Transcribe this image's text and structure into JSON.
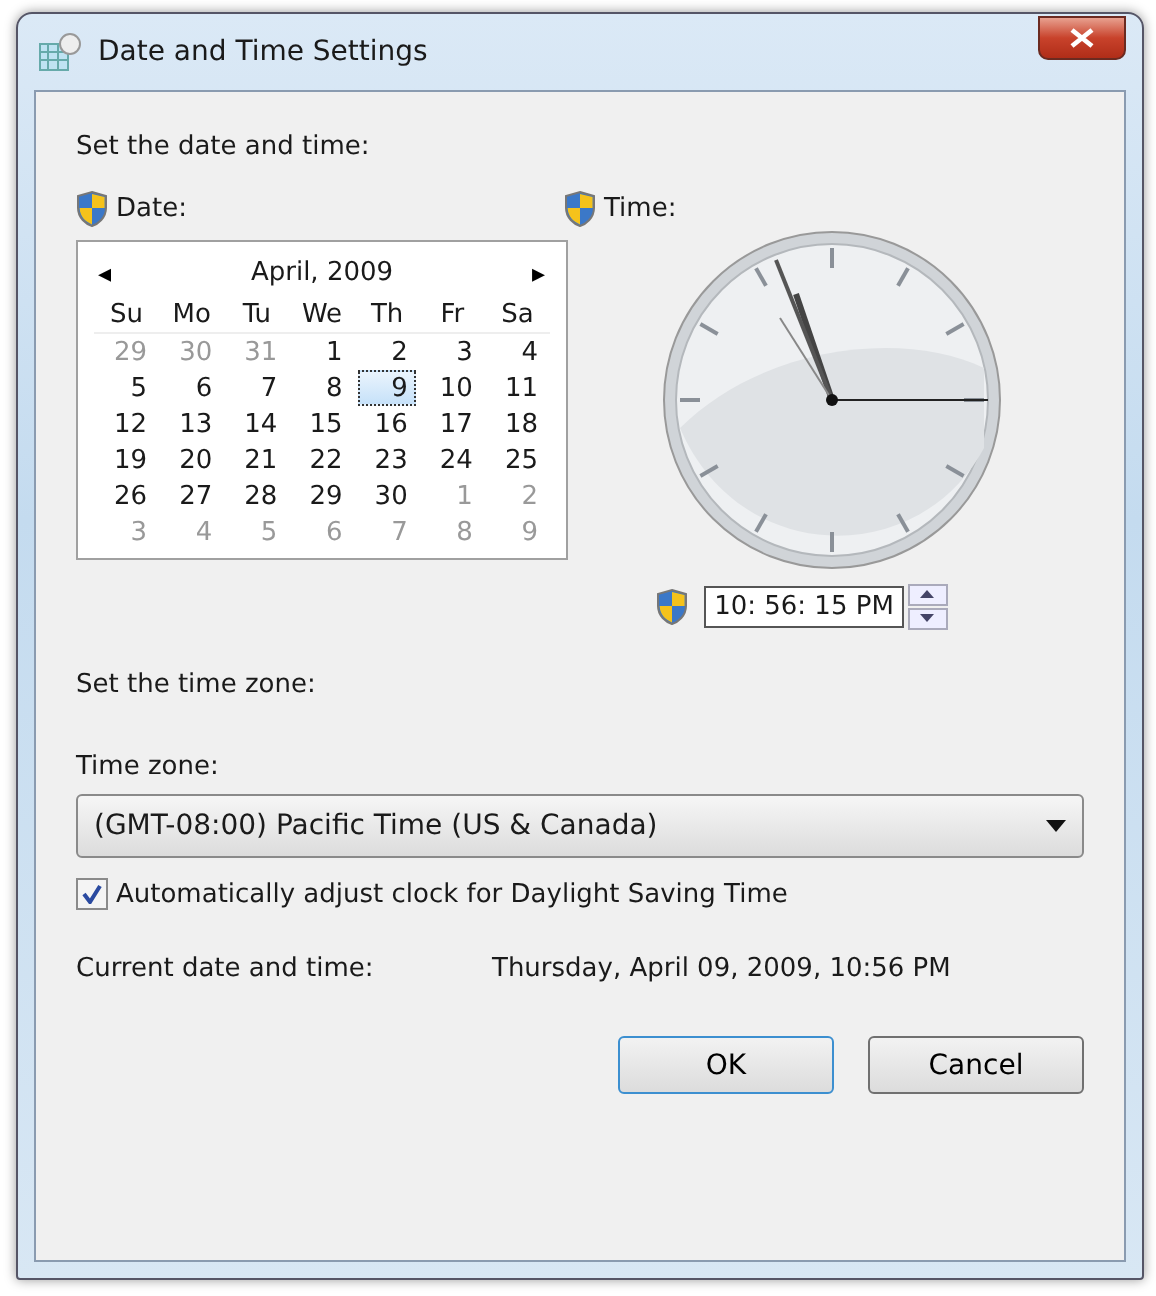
{
  "window": {
    "title": "Date and Time Settings"
  },
  "set_heading": "Set the date and time:",
  "date": {
    "label": "Date:",
    "month_title": "April, 2009",
    "prev": "◂",
    "next": "▸",
    "weekdays": [
      "Su",
      "Mo",
      "Tu",
      "We",
      "Th",
      "Fr",
      "Sa"
    ],
    "weeks": [
      [
        {
          "label": "29",
          "other_month": true,
          "selected": false
        },
        {
          "label": "30",
          "other_month": true,
          "selected": false
        },
        {
          "label": "31",
          "other_month": true,
          "selected": false
        },
        {
          "label": "1",
          "other_month": false,
          "selected": false
        },
        {
          "label": "2",
          "other_month": false,
          "selected": false
        },
        {
          "label": "3",
          "other_month": false,
          "selected": false
        },
        {
          "label": "4",
          "other_month": false,
          "selected": false
        }
      ],
      [
        {
          "label": "5",
          "other_month": false,
          "selected": false
        },
        {
          "label": "6",
          "other_month": false,
          "selected": false
        },
        {
          "label": "7",
          "other_month": false,
          "selected": false
        },
        {
          "label": "8",
          "other_month": false,
          "selected": false
        },
        {
          "label": "9",
          "other_month": false,
          "selected": true
        },
        {
          "label": "10",
          "other_month": false,
          "selected": false
        },
        {
          "label": "11",
          "other_month": false,
          "selected": false
        }
      ],
      [
        {
          "label": "12",
          "other_month": false,
          "selected": false
        },
        {
          "label": "13",
          "other_month": false,
          "selected": false
        },
        {
          "label": "14",
          "other_month": false,
          "selected": false
        },
        {
          "label": "15",
          "other_month": false,
          "selected": false
        },
        {
          "label": "16",
          "other_month": false,
          "selected": false
        },
        {
          "label": "17",
          "other_month": false,
          "selected": false
        },
        {
          "label": "18",
          "other_month": false,
          "selected": false
        }
      ],
      [
        {
          "label": "19",
          "other_month": false,
          "selected": false
        },
        {
          "label": "20",
          "other_month": false,
          "selected": false
        },
        {
          "label": "21",
          "other_month": false,
          "selected": false
        },
        {
          "label": "22",
          "other_month": false,
          "selected": false
        },
        {
          "label": "23",
          "other_month": false,
          "selected": false
        },
        {
          "label": "24",
          "other_month": false,
          "selected": false
        },
        {
          "label": "25",
          "other_month": false,
          "selected": false
        }
      ],
      [
        {
          "label": "26",
          "other_month": false,
          "selected": false
        },
        {
          "label": "27",
          "other_month": false,
          "selected": false
        },
        {
          "label": "28",
          "other_month": false,
          "selected": false
        },
        {
          "label": "29",
          "other_month": false,
          "selected": false
        },
        {
          "label": "30",
          "other_month": false,
          "selected": false
        },
        {
          "label": "1",
          "other_month": true,
          "selected": false
        },
        {
          "label": "2",
          "other_month": true,
          "selected": false
        }
      ],
      [
        {
          "label": "3",
          "other_month": true,
          "selected": false
        },
        {
          "label": "4",
          "other_month": true,
          "selected": false
        },
        {
          "label": "5",
          "other_month": true,
          "selected": false
        },
        {
          "label": "6",
          "other_month": true,
          "selected": false
        },
        {
          "label": "7",
          "other_month": true,
          "selected": false
        },
        {
          "label": "8",
          "other_month": true,
          "selected": false
        },
        {
          "label": "9",
          "other_month": true,
          "selected": false
        }
      ]
    ]
  },
  "time": {
    "label": "Time:",
    "value": "10: 56: 15 PM"
  },
  "zone_heading": "Set the time zone:",
  "time_zone": {
    "label": "Time zone:",
    "value": "(GMT-08:00) Pacific Time (US & Canada)"
  },
  "dst": {
    "label": "Automatically adjust clock for Daylight Saving Time",
    "checked": true
  },
  "current": {
    "label": "Current date and time:",
    "value": "Thursday, April 09, 2009, 10:56 PM"
  },
  "buttons": [
    {
      "label": "OK",
      "default": true
    },
    {
      "label": "Cancel",
      "default": false
    }
  ]
}
